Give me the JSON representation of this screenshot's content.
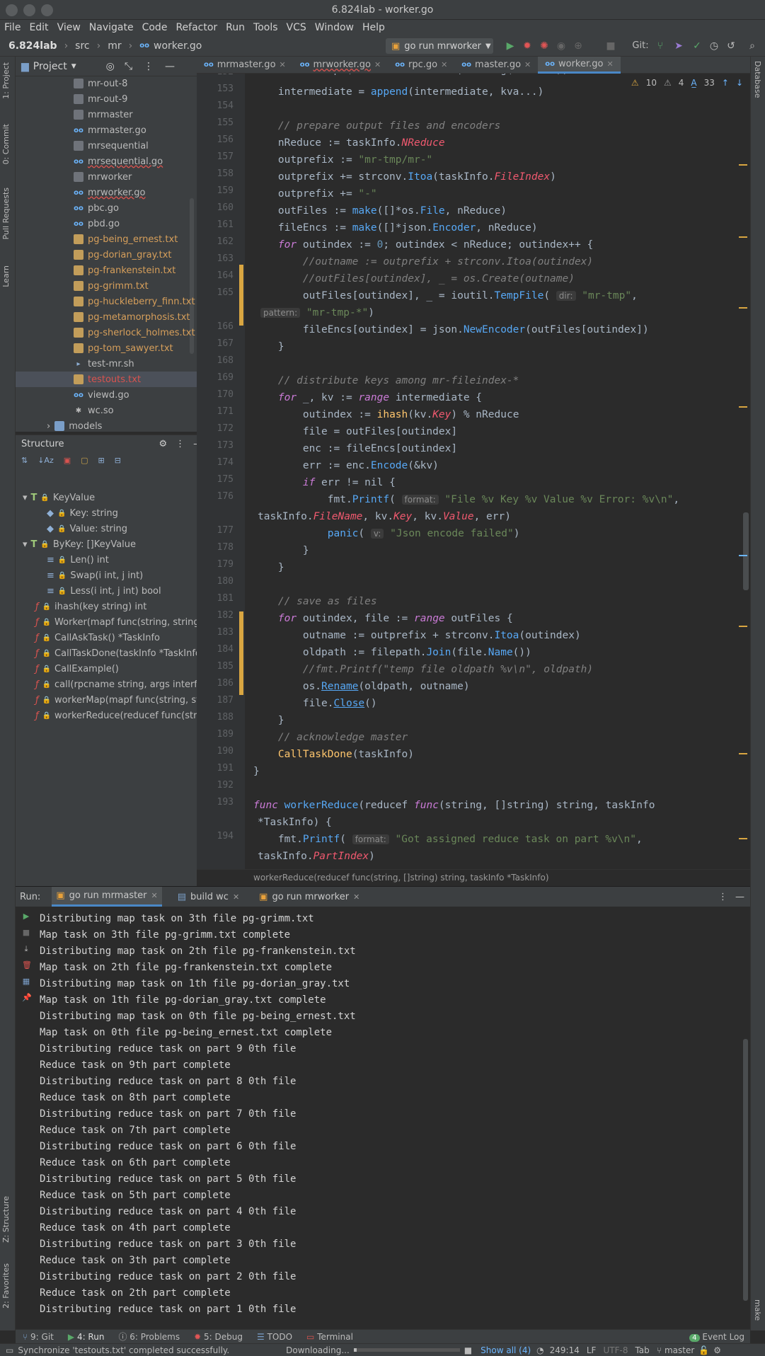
{
  "window": {
    "title": "6.824lab - worker.go"
  },
  "menu": [
    "File",
    "Edit",
    "View",
    "Navigate",
    "Code",
    "Refactor",
    "Run",
    "Tools",
    "VCS",
    "Window",
    "Help"
  ],
  "nav": {
    "project": "6.824lab",
    "crumbs": [
      "src",
      "mr",
      "worker.go"
    ]
  },
  "toolbar": {
    "run_config": "go run mrworker",
    "git_label": "Git:"
  },
  "left_strip": {
    "project": "1: Project",
    "commit": "0: Commit",
    "pull_requests": "Pull Requests",
    "learn": "Learn",
    "structure": "Z: Structure",
    "favorites": "2: Favorites"
  },
  "right_strip": {
    "database": "Database",
    "make": "make"
  },
  "project": {
    "header": "Project",
    "files": [
      "mr-out-8",
      "mr-out-9",
      "mrmaster",
      "mrmaster.go",
      "mrsequential",
      "mrsequential.go",
      "mrworker",
      "mrworker.go",
      "pbc.go",
      "pbd.go",
      "pg-being_ernest.txt",
      "pg-dorian_gray.txt",
      "pg-frankenstein.txt",
      "pg-grimm.txt",
      "pg-huckleberry_finn.txt",
      "pg-metamorphosis.txt",
      "pg-sherlock_holmes.txt",
      "pg-tom_sawyer.txt",
      "test-mr.sh",
      "testouts.txt",
      "viewd.go",
      "wc.so",
      "models"
    ]
  },
  "structure": {
    "header": "Structure",
    "items": [
      "KeyValue",
      "Key: string",
      "Value: string",
      "ByKey: []KeyValue",
      "Len() int",
      "Swap(i int, j int)",
      "Less(i int, j int) bool",
      "ihash(key string) int",
      "Worker(mapf func(string, string)",
      "CallAskTask() *TaskInfo",
      "CallTaskDone(taskInfo *TaskInfo",
      "CallExample()",
      "call(rpcname string, args interfac",
      "workerMap(mapf func(string, str",
      "workerReduce(reducef func(strin"
    ]
  },
  "tabs": [
    "mrmaster.go",
    "mrworker.go",
    "rpc.go",
    "master.go",
    "worker.go"
  ],
  "inspection": {
    "warnings": "10",
    "weak": "4",
    "typos": "33"
  },
  "editor": {
    "line_numbers": [
      "152",
      "153",
      "154",
      "155",
      "156",
      "157",
      "158",
      "159",
      "160",
      "161",
      "162",
      "163",
      "164",
      "165",
      "",
      "166",
      "167",
      "168",
      "169",
      "170",
      "171",
      "172",
      "173",
      "174",
      "175",
      "176",
      "",
      "177",
      "178",
      "179",
      "180",
      "181",
      "182",
      "183",
      "184",
      "185",
      "186",
      "187",
      "188",
      "189",
      "190",
      "191",
      "192",
      "193",
      "",
      "194",
      ""
    ],
    "breadcrumb": "workerReduce(reducef func(string, []string) string, taskInfo *TaskInfo)"
  },
  "run": {
    "label": "Run:",
    "tabs": [
      "go run mrmaster",
      "build wc",
      "go run mrworker"
    ],
    "output": [
      "Distributing map task on 3th file pg-grimm.txt",
      "Map task on 3th file pg-grimm.txt complete",
      "Distributing map task on 2th file pg-frankenstein.txt",
      "Map task on 2th file pg-frankenstein.txt complete",
      "Distributing map task on 1th file pg-dorian_gray.txt",
      "Map task on 1th file pg-dorian_gray.txt complete",
      "Distributing map task on 0th file pg-being_ernest.txt",
      "Map task on 0th file pg-being_ernest.txt complete",
      "Distributing reduce task on part 9 0th file",
      "Reduce task on 9th part complete",
      "Distributing reduce task on part 8 0th file",
      "Reduce task on 8th part complete",
      "Distributing reduce task on part 7 0th file",
      "Reduce task on 7th part complete",
      "Distributing reduce task on part 6 0th file",
      "Reduce task on 6th part complete",
      "Distributing reduce task on part 5 0th file",
      "Reduce task on 5th part complete",
      "Distributing reduce task on part 4 0th file",
      "Reduce task on 4th part complete",
      "Distributing reduce task on part 3 0th file",
      "Reduce task on 3th part complete",
      "Distributing reduce task on part 2 0th file",
      "Reduce task on 2th part complete",
      "Distributing reduce task on part 1 0th file"
    ]
  },
  "bottom_tools": [
    "9: Git",
    "4: Run",
    "6: Problems",
    "5: Debug",
    "TODO",
    "Terminal"
  ],
  "event_log": {
    "count": "4",
    "label": "Event Log"
  },
  "status": {
    "message": "Synchronize 'testouts.txt' completed successfully.",
    "downloading": "Downloading...",
    "show_all": "Show all (4)",
    "position": "249:14",
    "line_sep": "LF",
    "encoding": "UTF-8",
    "indent": "Tab",
    "branch": "master"
  }
}
